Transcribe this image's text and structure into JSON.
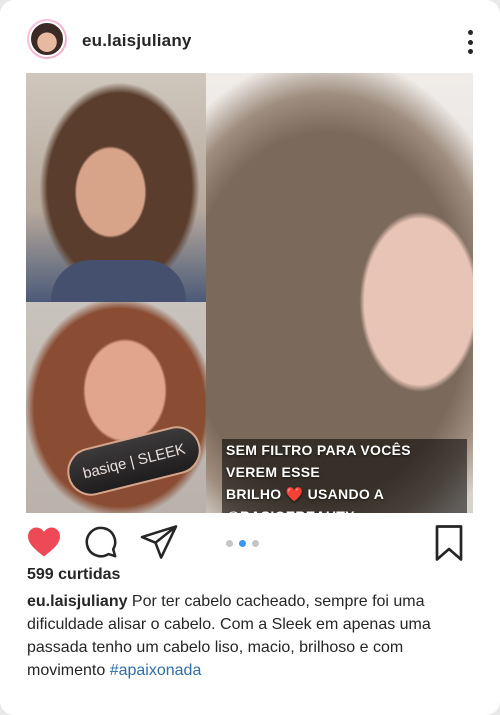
{
  "post": {
    "username": "eu.laisjuliany",
    "overlay_lines": [
      "SEM FILTRO PARA VOCÊS VEREM ESSE",
      "BRILHO ❤️ USANDO A @BASIQEBEAUTY"
    ],
    "brush_label": "basiqe | SLEEK",
    "likes": "599 curtidas",
    "caption_user": "eu.laisjuliany",
    "caption_text": " Por ter cabelo cacheado, sempre foi uma dificuldade alisar o cabelo. Com a Sleek em apenas uma passada tenho um cabelo liso, macio, brilhoso e com movimento ",
    "hashtag": "#apaixonada",
    "carousel_count": 3,
    "carousel_active": 2
  },
  "colors": {
    "heart": "#ed4956",
    "active_dot": "#3897f0",
    "hashtag": "#2f6ea8"
  },
  "icons": [
    "more-options-icon",
    "heart-icon",
    "comment-icon",
    "share-icon",
    "bookmark-icon"
  ]
}
